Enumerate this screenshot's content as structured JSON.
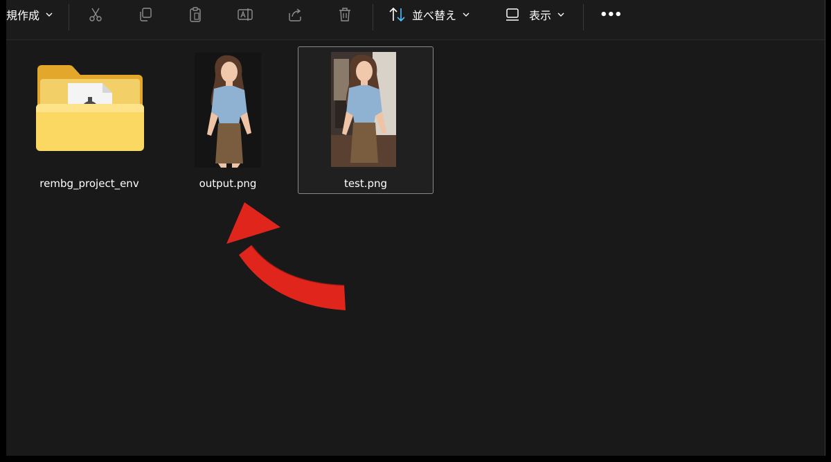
{
  "toolbar": {
    "new_label": "規作成",
    "sort_label": "並べ替え",
    "view_label": "表示",
    "more_label": "•••"
  },
  "files": [
    {
      "name": "rembg_project_env",
      "kind": "folder"
    },
    {
      "name": "output.png",
      "kind": "image"
    },
    {
      "name": "test.png",
      "kind": "image",
      "selected": true
    }
  ],
  "colors": {
    "background": "#191919",
    "accent_blue": "#4cc2ff",
    "folder_yellow": "#f5c542",
    "arrow_red": "#e0261c"
  }
}
